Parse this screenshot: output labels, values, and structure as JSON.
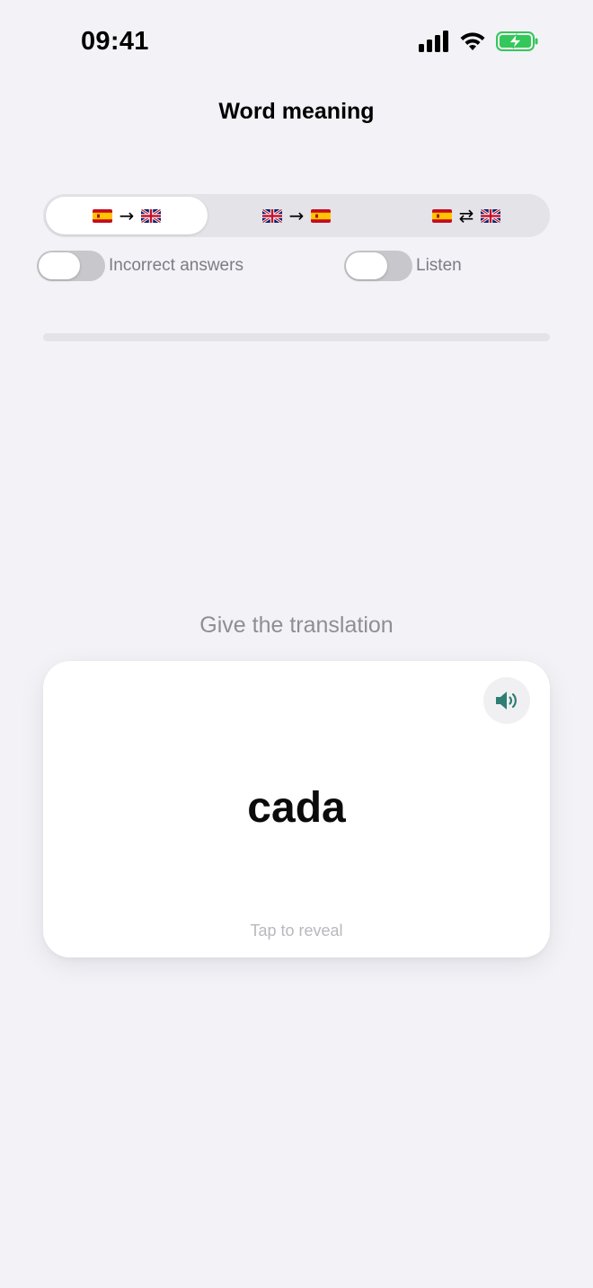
{
  "status_bar": {
    "time": "09:41",
    "icons": [
      "signal-icon",
      "wifi-icon",
      "battery-charging-icon"
    ],
    "battery_color": "#34c759"
  },
  "header": {
    "title": "Word meaning"
  },
  "direction_modes": [
    {
      "from_flag": "flag-spain-icon",
      "arrow": "→",
      "to_flag": "flag-uk-icon",
      "selected": true
    },
    {
      "from_flag": "flag-uk-icon",
      "arrow": "→",
      "to_flag": "flag-spain-icon",
      "selected": false
    },
    {
      "from_flag": "flag-spain-icon",
      "arrow": "⇄",
      "to_flag": "flag-uk-icon",
      "selected": false
    }
  ],
  "toggles": {
    "incorrect_answers": {
      "label": "Incorrect answers",
      "on": false
    },
    "listen": {
      "label": "Listen",
      "on": false
    }
  },
  "progress": {
    "fraction": 0
  },
  "quiz": {
    "prompt": "Give the translation",
    "word": "cada",
    "hint": "Tap to reveal",
    "speaker_icon": "speaker-icon"
  },
  "colors": {
    "background": "#f2f2f7",
    "accent": "#2f7d73",
    "card": "#ffffff",
    "secondary_text": "#8e8e93"
  }
}
